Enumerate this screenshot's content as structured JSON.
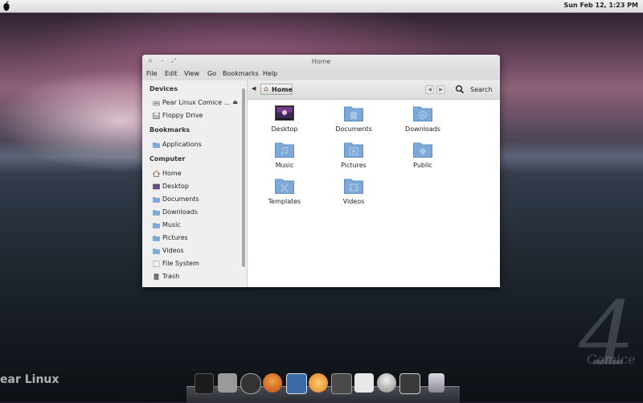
{
  "topbar": {
    "clock": "Sun Feb 12,  1:23 PM"
  },
  "desktop": {
    "brand_text": "ear Linux",
    "watermark_number": "4",
    "watermark_text": "Comice"
  },
  "window": {
    "title": "Home",
    "controls": [
      "×",
      "–",
      "⤢"
    ],
    "menu": [
      "File",
      "Edit",
      "View",
      "Go",
      "Bookmarks",
      "Help"
    ]
  },
  "sidebar": {
    "sections": [
      {
        "heading": "Devices",
        "items": [
          {
            "label": "Pear Linux Comice ...",
            "icon": "drive-icon",
            "eject": "⏏"
          },
          {
            "label": "Floppy Drive",
            "icon": "floppy-icon"
          }
        ]
      },
      {
        "heading": "Bookmarks",
        "items": [
          {
            "label": "Applications",
            "icon": "folder-icon"
          }
        ]
      },
      {
        "heading": "Computer",
        "items": [
          {
            "label": "Home",
            "icon": "home-icon"
          },
          {
            "label": "Desktop",
            "icon": "desktop-icon"
          },
          {
            "label": "Documents",
            "icon": "folder-icon"
          },
          {
            "label": "Downloads",
            "icon": "folder-icon"
          },
          {
            "label": "Music",
            "icon": "folder-icon"
          },
          {
            "label": "Pictures",
            "icon": "folder-icon"
          },
          {
            "label": "Videos",
            "icon": "folder-icon"
          },
          {
            "label": "File System",
            "icon": "filesystem-icon"
          },
          {
            "label": "Trash",
            "icon": "trash-icon"
          }
        ]
      }
    ]
  },
  "toolbar": {
    "crumb": "Home",
    "search_label": "Search"
  },
  "files": [
    {
      "label": "Desktop",
      "icon": "desktop-folder-icon"
    },
    {
      "label": "Documents",
      "icon": "documents-folder-icon"
    },
    {
      "label": "Downloads",
      "icon": "downloads-folder-icon"
    },
    {
      "label": "Music",
      "icon": "music-folder-icon"
    },
    {
      "label": "Pictures",
      "icon": "pictures-folder-icon"
    },
    {
      "label": "Public",
      "icon": "public-folder-icon"
    },
    {
      "label": "Templates",
      "icon": "templates-folder-icon"
    },
    {
      "label": "Videos",
      "icon": "videos-folder-icon"
    }
  ],
  "dock": [
    {
      "name": "monitor-icon",
      "color": "#222222"
    },
    {
      "name": "rocket-icon",
      "color": "#9a9a9a"
    },
    {
      "name": "app-store-icon",
      "color": "#333333"
    },
    {
      "name": "firefox-icon",
      "color": "#e8742a"
    },
    {
      "name": "mail-icon",
      "color": "#3a6aa8"
    },
    {
      "name": "burner-icon",
      "color": "#f5a030"
    },
    {
      "name": "video-player-icon",
      "color": "#555555"
    },
    {
      "name": "document-icon",
      "color": "#e8e8e8"
    },
    {
      "name": "user-icon",
      "color": "#c8c8c8"
    },
    {
      "name": "terminal-icon",
      "color": "#3a3a3a"
    },
    {
      "name": "trash-dock-icon",
      "color": "#bfbfc8"
    }
  ],
  "colors": {
    "folder": "#7ea9d6",
    "folder_dark": "#5f8fc4"
  }
}
